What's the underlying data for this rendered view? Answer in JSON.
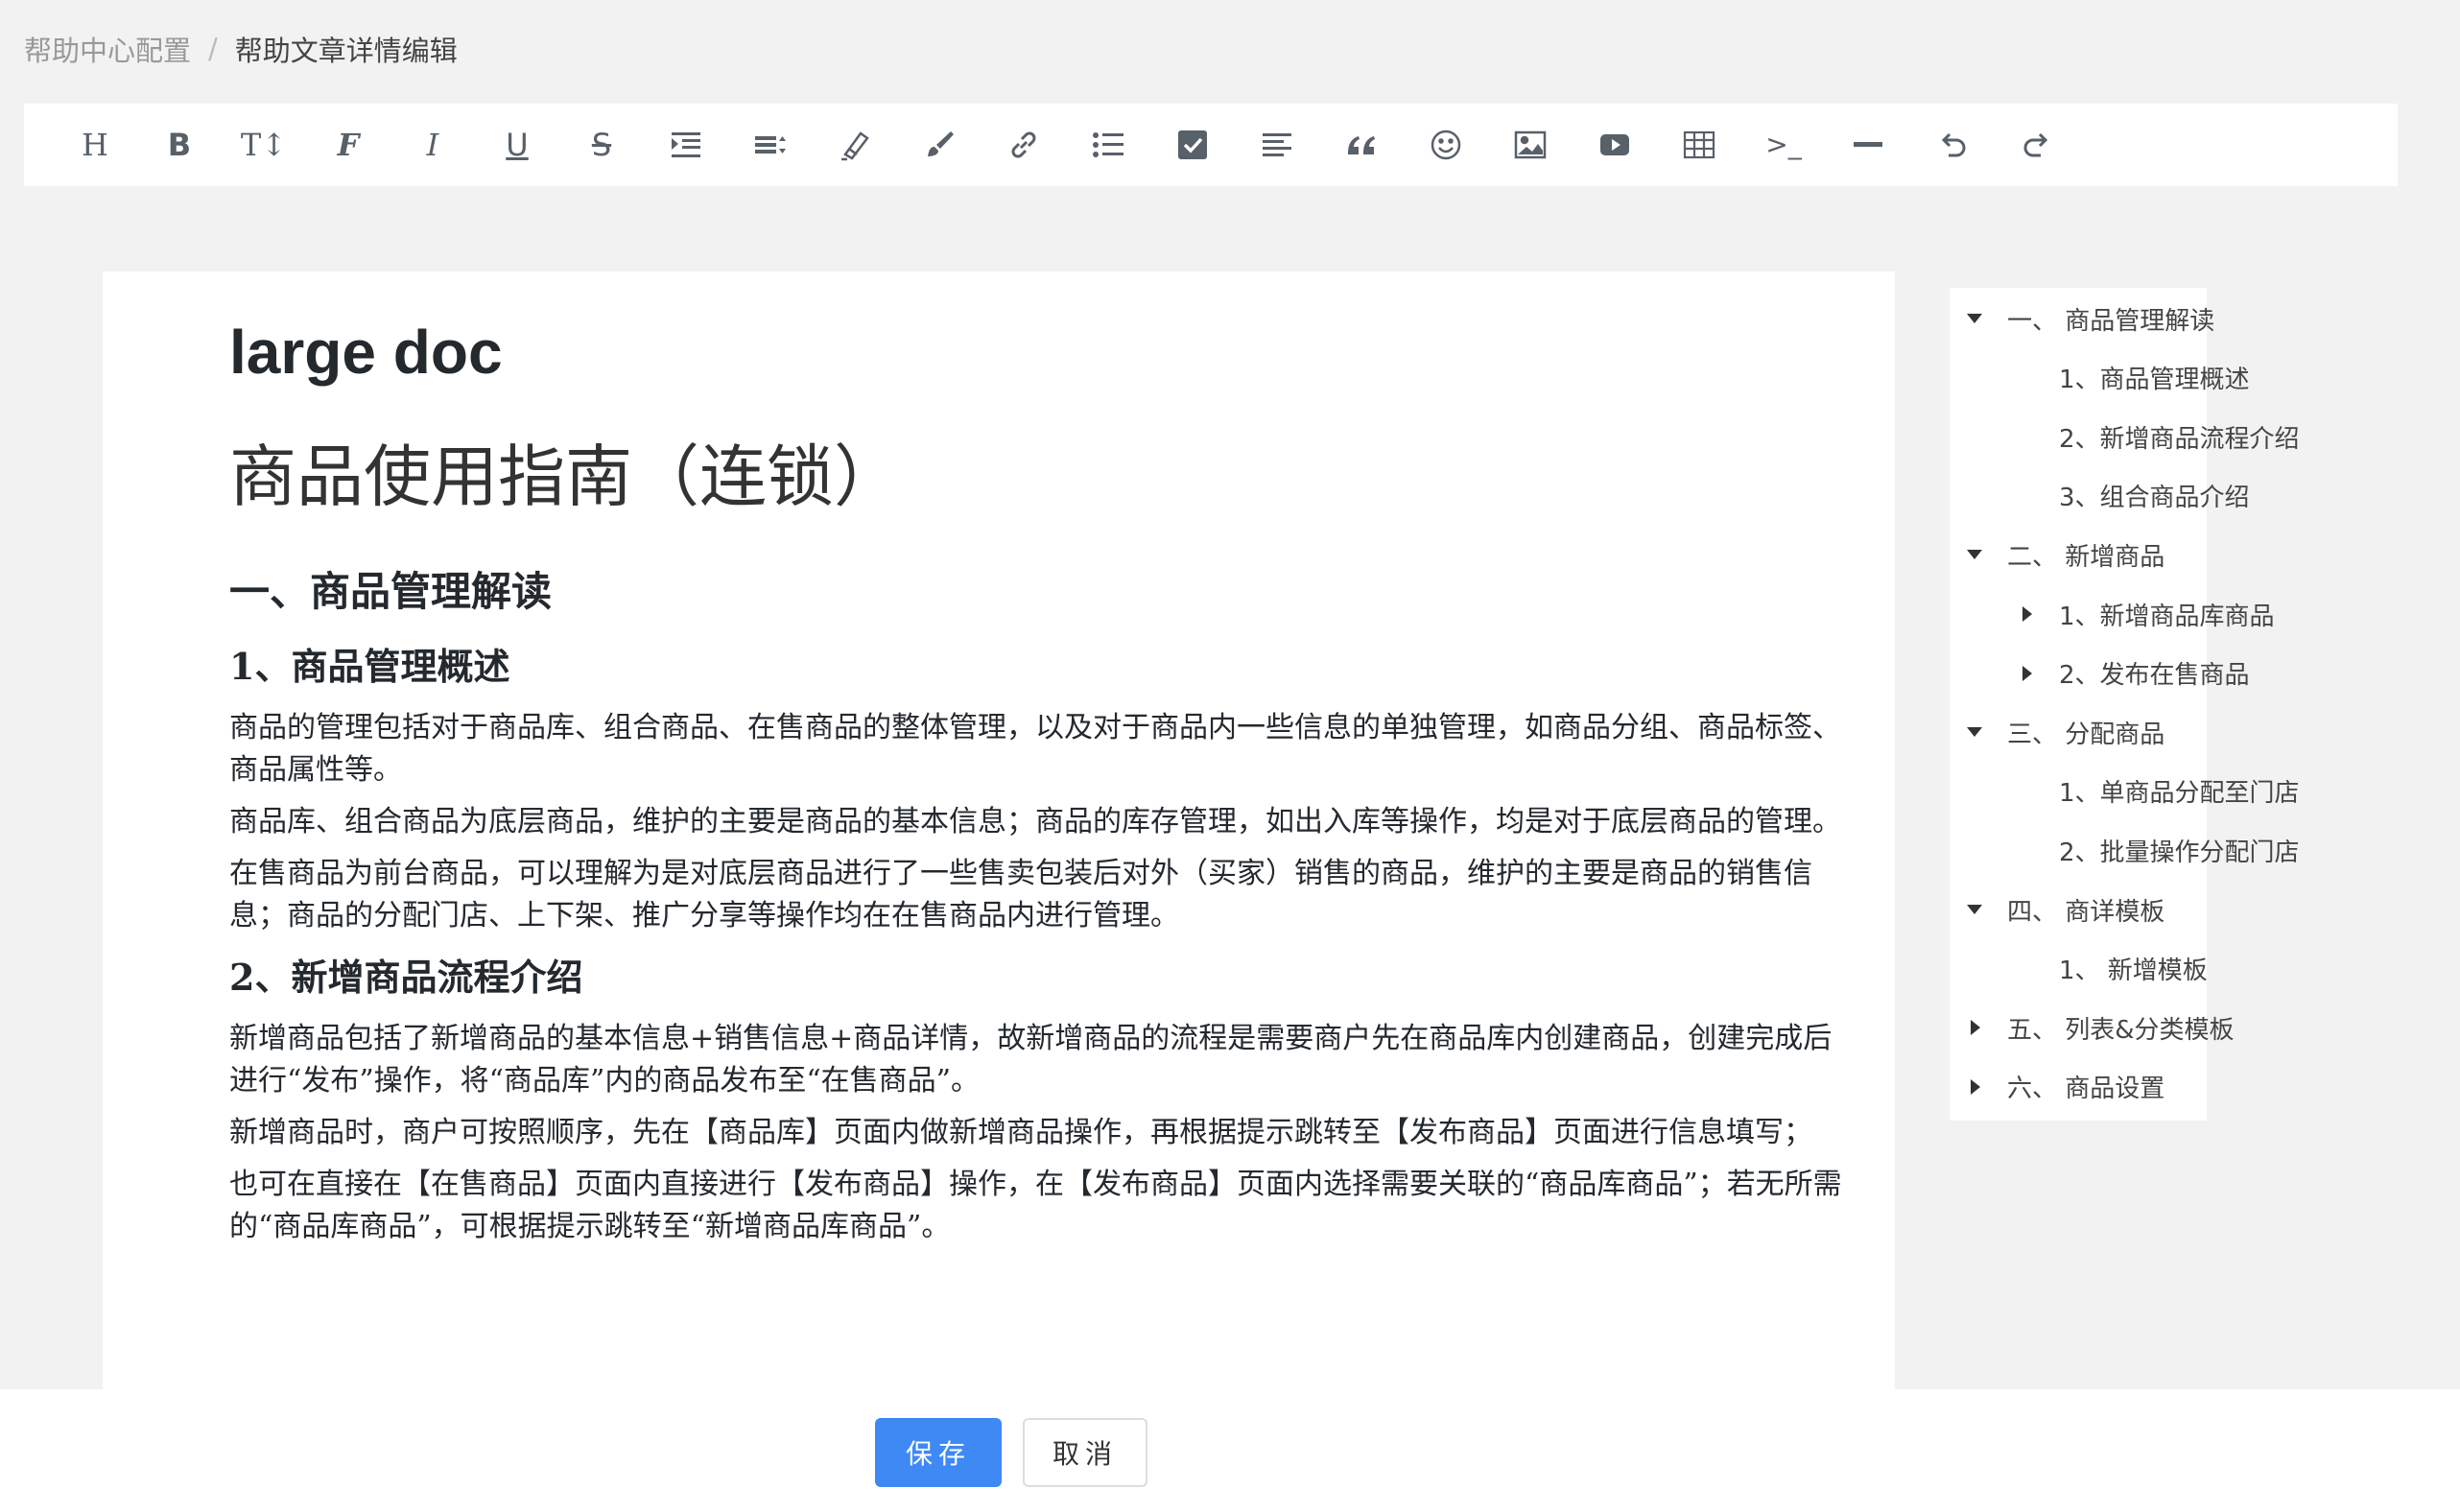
{
  "breadcrumb": {
    "parent": "帮助中心配置",
    "separator": "/",
    "current": "帮助文章详情编辑"
  },
  "toolbar": {
    "tools": [
      "heading-icon",
      "bold-icon",
      "font-size-icon",
      "font-icon",
      "italic-icon",
      "underline-icon",
      "strikethrough-icon",
      "indent-icon",
      "line-height-icon",
      "highlight-icon",
      "brush-icon",
      "link-icon",
      "bullet-list-icon",
      "checkbox-icon",
      "align-icon",
      "quote-icon",
      "emoji-icon",
      "image-icon",
      "video-icon",
      "table-icon",
      "code-icon",
      "horizontal-rule-icon",
      "undo-icon",
      "redo-icon"
    ],
    "labels": {
      "heading": "H",
      "bold": "B",
      "italic": "I",
      "font_size": "T↕",
      "font": "F",
      "underline": "U",
      "strike": "S",
      "code": ">_"
    }
  },
  "document": {
    "doc_title": "large doc",
    "h1": "商品使用指南（连锁）",
    "section1_title": "一、商品管理解读",
    "sub1_title": "1、商品管理概述",
    "sub1_p1": "商品的管理包括对于商品库、组合商品、在售商品的整体管理，以及对于商品内一些信息的单独管理，如商品分组、商品标签、商品属性等。",
    "sub1_p2": "商品库、组合商品为底层商品，维护的主要是商品的基本信息；商品的库存管理，如出入库等操作，均是对于底层商品的管理。",
    "sub1_p3": "在售商品为前台商品，可以理解为是对底层商品进行了一些售卖包装后对外（买家）销售的商品，维护的主要是商品的销售信息；商品的分配门店、上下架、推广分享等操作均在在售商品内进行管理。",
    "sub2_title": "2、新增商品流程介绍",
    "sub2_p1": "新增商品包括了新增商品的基本信息+销售信息+商品详情，故新增商品的流程是需要商户先在商品库内创建商品，创建完成后进行“发布”操作，将“商品库”内的商品发布至“在售商品”。",
    "sub2_p2": "新增商品时，商户可按照顺序，先在【商品库】页面内做新增商品操作，再根据提示跳转至【发布商品】页面进行信息填写；",
    "sub2_p3": "也可在直接在【在售商品】页面内直接进行【发布商品】操作，在【发布商品】页面内选择需要关联的“商品库商品”；若无所需的“商品库商品”，可根据提示跳转至“新增商品库商品”。"
  },
  "outline": {
    "items": [
      {
        "label": "一、 商品管理解读",
        "caret": "down"
      },
      {
        "label": "1、商品管理概述",
        "caret": ""
      },
      {
        "label": "2、新增商品流程介绍",
        "caret": ""
      },
      {
        "label": "3、组合商品介绍",
        "caret": ""
      },
      {
        "label": "二、 新增商品",
        "caret": "down"
      },
      {
        "label": "1、新增商品库商品",
        "caret": "right"
      },
      {
        "label": "2、发布在售商品",
        "caret": "right"
      },
      {
        "label": "三、 分配商品",
        "caret": "down"
      },
      {
        "label": "1、单商品分配至门店",
        "caret": ""
      },
      {
        "label": "2、批量操作分配门店",
        "caret": ""
      },
      {
        "label": "四、 商详模板",
        "caret": "down"
      },
      {
        "label": "1、 新增模板",
        "caret": ""
      },
      {
        "label": "五、 列表&分类模板",
        "caret": "right"
      },
      {
        "label": "六、 商品设置",
        "caret": "right"
      }
    ]
  },
  "actions": {
    "save": "保存",
    "cancel": "取消"
  }
}
